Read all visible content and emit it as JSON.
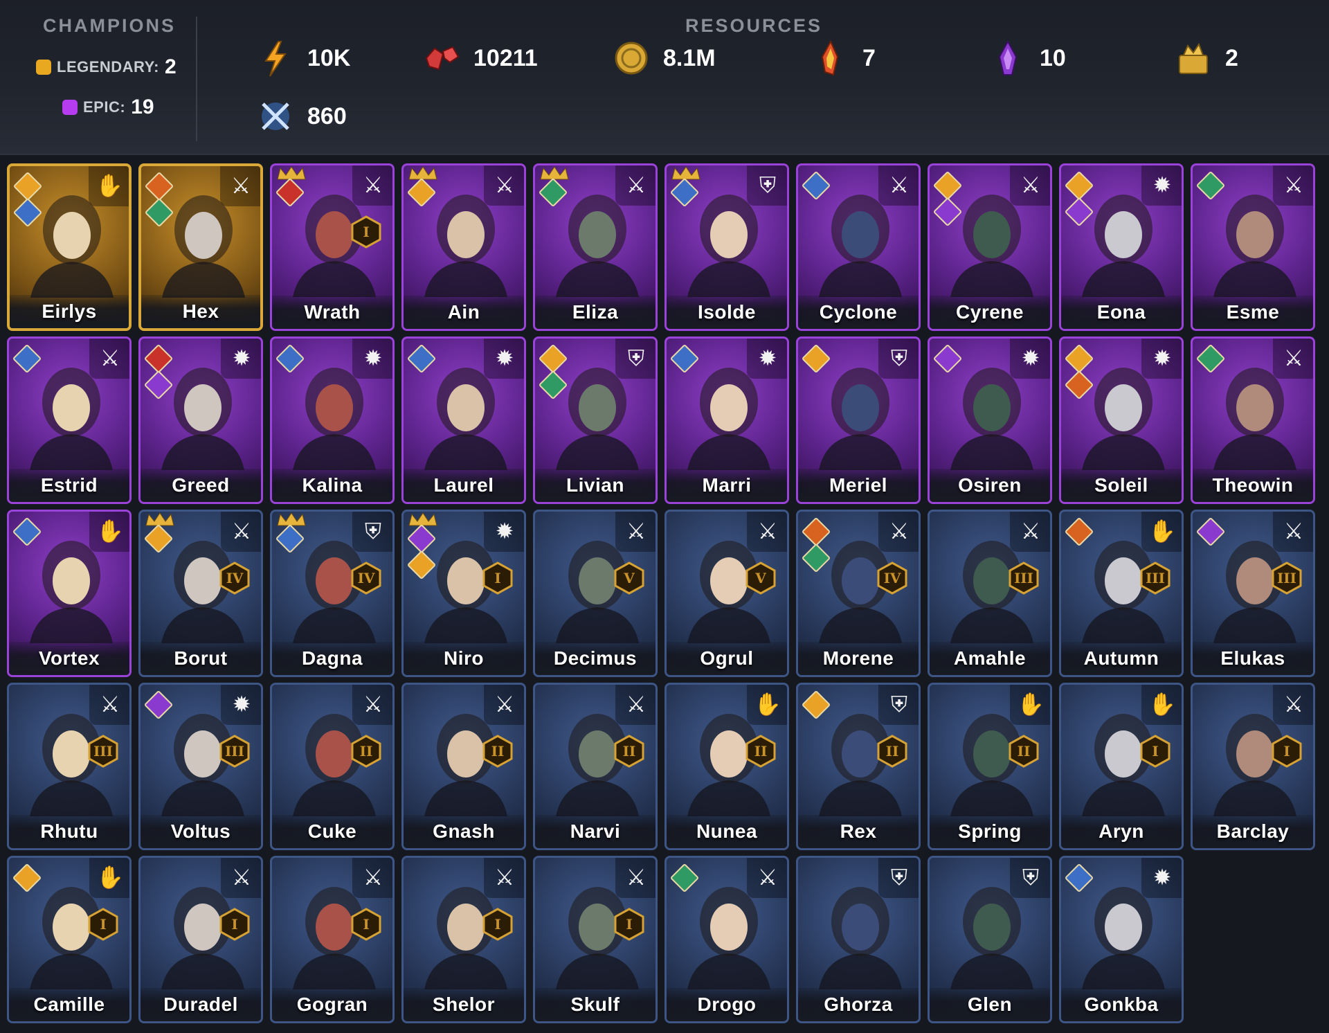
{
  "champions": {
    "title": "CHAMPIONS",
    "legendary": {
      "label": "LEGENDARY:",
      "count": "2",
      "color": "#e8a820"
    },
    "epic": {
      "label": "EPIC:",
      "count": "19",
      "color": "#b63cf0"
    }
  },
  "resources": {
    "title": "RESOURCES",
    "items": [
      {
        "icon": "lightning-energy-icon",
        "value": "10K"
      },
      {
        "icon": "ruby-gems-icon",
        "value": "10211"
      },
      {
        "icon": "gold-coin-icon",
        "value": "8.1M"
      },
      {
        "icon": "fire-crystal-icon",
        "value": "7"
      },
      {
        "icon": "purple-crystal-icon",
        "value": "10"
      },
      {
        "icon": "treasure-hoard-icon",
        "value": "2"
      },
      {
        "icon": "crossed-swords-icon",
        "value": "860"
      }
    ]
  },
  "cards": [
    {
      "name": "Eirlys",
      "rarity": "legendary",
      "role": "hands-icon",
      "affinities": [
        "gold",
        "blue"
      ],
      "crown": false,
      "awaken": ""
    },
    {
      "name": "Hex",
      "rarity": "legendary",
      "role": "crossed-axes-icon",
      "affinities": [
        "orange",
        "green"
      ],
      "crown": false,
      "awaken": ""
    },
    {
      "name": "Wrath",
      "rarity": "epic",
      "role": "sword-icon",
      "affinities": [
        "red"
      ],
      "crown": true,
      "awaken": "I"
    },
    {
      "name": "Ain",
      "rarity": "epic",
      "role": "sword-icon",
      "affinities": [
        "gold"
      ],
      "crown": true,
      "awaken": ""
    },
    {
      "name": "Eliza",
      "rarity": "epic",
      "role": "crossed-axes-icon",
      "affinities": [
        "green"
      ],
      "crown": true,
      "awaken": ""
    },
    {
      "name": "Isolde",
      "rarity": "epic",
      "role": "shield-icon",
      "affinities": [
        "blue"
      ],
      "crown": true,
      "awaken": ""
    },
    {
      "name": "Cyclone",
      "rarity": "epic",
      "role": "sword-icon",
      "affinities": [
        "blue"
      ],
      "crown": false,
      "awaken": ""
    },
    {
      "name": "Cyrene",
      "rarity": "epic",
      "role": "sword-icon",
      "affinities": [
        "gold",
        "purple"
      ],
      "crown": false,
      "awaken": ""
    },
    {
      "name": "Eona",
      "rarity": "epic",
      "role": "magic-staff-icon",
      "affinities": [
        "gold",
        "purple"
      ],
      "crown": false,
      "awaken": ""
    },
    {
      "name": "Esme",
      "rarity": "epic",
      "role": "crossed-axes-icon",
      "affinities": [
        "green"
      ],
      "crown": false,
      "awaken": ""
    },
    {
      "name": "Estrid",
      "rarity": "epic",
      "role": "sword-icon",
      "affinities": [
        "blue"
      ],
      "crown": false,
      "awaken": ""
    },
    {
      "name": "Greed",
      "rarity": "epic",
      "role": "magic-staff-icon",
      "affinities": [
        "red",
        "purple"
      ],
      "crown": false,
      "awaken": ""
    },
    {
      "name": "Kalina",
      "rarity": "epic",
      "role": "magic-staff-icon",
      "affinities": [
        "blue"
      ],
      "crown": false,
      "awaken": ""
    },
    {
      "name": "Laurel",
      "rarity": "epic",
      "role": "magic-staff-icon",
      "affinities": [
        "blue"
      ],
      "crown": false,
      "awaken": ""
    },
    {
      "name": "Livian",
      "rarity": "epic",
      "role": "shield-icon",
      "affinities": [
        "gold",
        "green"
      ],
      "crown": false,
      "awaken": ""
    },
    {
      "name": "Marri",
      "rarity": "epic",
      "role": "magic-staff-icon",
      "affinities": [
        "blue"
      ],
      "crown": false,
      "awaken": ""
    },
    {
      "name": "Meriel",
      "rarity": "epic",
      "role": "shield-icon",
      "affinities": [
        "gold"
      ],
      "crown": false,
      "awaken": ""
    },
    {
      "name": "Osiren",
      "rarity": "epic",
      "role": "magic-staff-icon",
      "affinities": [
        "purple"
      ],
      "crown": false,
      "awaken": ""
    },
    {
      "name": "Soleil",
      "rarity": "epic",
      "role": "magic-staff-icon",
      "affinities": [
        "gold",
        "orange"
      ],
      "crown": false,
      "awaken": ""
    },
    {
      "name": "Theowin",
      "rarity": "epic",
      "role": "crossed-axes-icon",
      "affinities": [
        "green"
      ],
      "crown": false,
      "awaken": ""
    },
    {
      "name": "Vortex",
      "rarity": "epic",
      "role": "hands-icon",
      "affinities": [
        "blue"
      ],
      "crown": false,
      "awaken": ""
    },
    {
      "name": "Borut",
      "rarity": "rare",
      "role": "sword-icon",
      "affinities": [
        "gold"
      ],
      "crown": true,
      "awaken": "IV"
    },
    {
      "name": "Dagna",
      "rarity": "rare",
      "role": "shield-icon",
      "affinities": [
        "blue"
      ],
      "crown": true,
      "awaken": "IV"
    },
    {
      "name": "Niro",
      "rarity": "rare",
      "role": "magic-staff-icon",
      "affinities": [
        "purple",
        "gold"
      ],
      "crown": true,
      "awaken": "I"
    },
    {
      "name": "Decimus",
      "rarity": "rare",
      "role": "sword-icon",
      "affinities": [],
      "crown": false,
      "awaken": "V"
    },
    {
      "name": "Ogrul",
      "rarity": "rare",
      "role": "sword-icon",
      "affinities": [],
      "crown": false,
      "awaken": "V"
    },
    {
      "name": "Morene",
      "rarity": "rare",
      "role": "crossed-axes-icon",
      "affinities": [
        "orange",
        "green"
      ],
      "crown": false,
      "awaken": "IV"
    },
    {
      "name": "Amahle",
      "rarity": "rare",
      "role": "crossed-axes-icon",
      "affinities": [],
      "crown": false,
      "awaken": "III"
    },
    {
      "name": "Autumn",
      "rarity": "rare",
      "role": "hands-icon",
      "affinities": [
        "orange"
      ],
      "crown": false,
      "awaken": "III"
    },
    {
      "name": "Elukas",
      "rarity": "rare",
      "role": "crossed-axes-icon",
      "affinities": [
        "purple"
      ],
      "crown": false,
      "awaken": "III"
    },
    {
      "name": "Rhutu",
      "rarity": "rare",
      "role": "sword-icon",
      "affinities": [],
      "crown": false,
      "awaken": "III"
    },
    {
      "name": "Voltus",
      "rarity": "rare",
      "role": "magic-staff-icon",
      "affinities": [
        "purple"
      ],
      "crown": false,
      "awaken": "III"
    },
    {
      "name": "Cuke",
      "rarity": "rare",
      "role": "crossed-axes-icon",
      "affinities": [],
      "crown": false,
      "awaken": "II"
    },
    {
      "name": "Gnash",
      "rarity": "rare",
      "role": "sword-icon",
      "affinities": [],
      "crown": false,
      "awaken": "II"
    },
    {
      "name": "Narvi",
      "rarity": "rare",
      "role": "sword-icon",
      "affinities": [],
      "crown": false,
      "awaken": "II"
    },
    {
      "name": "Nunea",
      "rarity": "rare",
      "role": "hands-icon",
      "affinities": [],
      "crown": false,
      "awaken": "II"
    },
    {
      "name": "Rex",
      "rarity": "rare",
      "role": "shield-icon",
      "affinities": [
        "gold"
      ],
      "crown": false,
      "awaken": "II"
    },
    {
      "name": "Spring",
      "rarity": "rare",
      "role": "hands-icon",
      "affinities": [],
      "crown": false,
      "awaken": "II"
    },
    {
      "name": "Aryn",
      "rarity": "rare",
      "role": "hands-icon",
      "affinities": [],
      "crown": false,
      "awaken": "I"
    },
    {
      "name": "Barclay",
      "rarity": "rare",
      "role": "sword-icon",
      "affinities": [],
      "crown": false,
      "awaken": "I"
    },
    {
      "name": "Camille",
      "rarity": "rare",
      "role": "hands-icon",
      "affinities": [
        "gold"
      ],
      "crown": false,
      "awaken": "I"
    },
    {
      "name": "Duradel",
      "rarity": "rare",
      "role": "sword-icon",
      "affinities": [],
      "crown": false,
      "awaken": "I"
    },
    {
      "name": "Gogran",
      "rarity": "rare",
      "role": "sword-icon",
      "affinities": [],
      "crown": false,
      "awaken": "I"
    },
    {
      "name": "Shelor",
      "rarity": "rare",
      "role": "sword-icon",
      "affinities": [],
      "crown": false,
      "awaken": "I"
    },
    {
      "name": "Skulf",
      "rarity": "rare",
      "role": "sword-icon",
      "affinities": [],
      "crown": false,
      "awaken": "I"
    },
    {
      "name": "Drogo",
      "rarity": "rare",
      "role": "crossed-axes-icon",
      "affinities": [
        "green"
      ],
      "crown": false,
      "awaken": ""
    },
    {
      "name": "Ghorza",
      "rarity": "rare",
      "role": "shield-icon",
      "affinities": [],
      "crown": false,
      "awaken": ""
    },
    {
      "name": "Glen",
      "rarity": "rare",
      "role": "shield-icon",
      "affinities": [],
      "crown": false,
      "awaken": ""
    },
    {
      "name": "Gonkba",
      "rarity": "rare",
      "role": "magic-staff-icon",
      "affinities": [
        "blue"
      ],
      "crown": false,
      "awaken": ""
    }
  ],
  "colors": {
    "affinity": {
      "gold": "#e9a126",
      "blue": "#3d6fc7",
      "green": "#2f9a63",
      "red": "#c8322a",
      "orange": "#d8621f",
      "purple": "#8b3ad0"
    },
    "portrait": [
      "#e8d3b0",
      "#cfc6c0",
      "#a8524a",
      "#d9c2a8",
      "#6b7a6b",
      "#e5cdb5",
      "#3b4c78",
      "#3f5a4e",
      "#c9c9cf",
      "#b08a7a"
    ]
  }
}
